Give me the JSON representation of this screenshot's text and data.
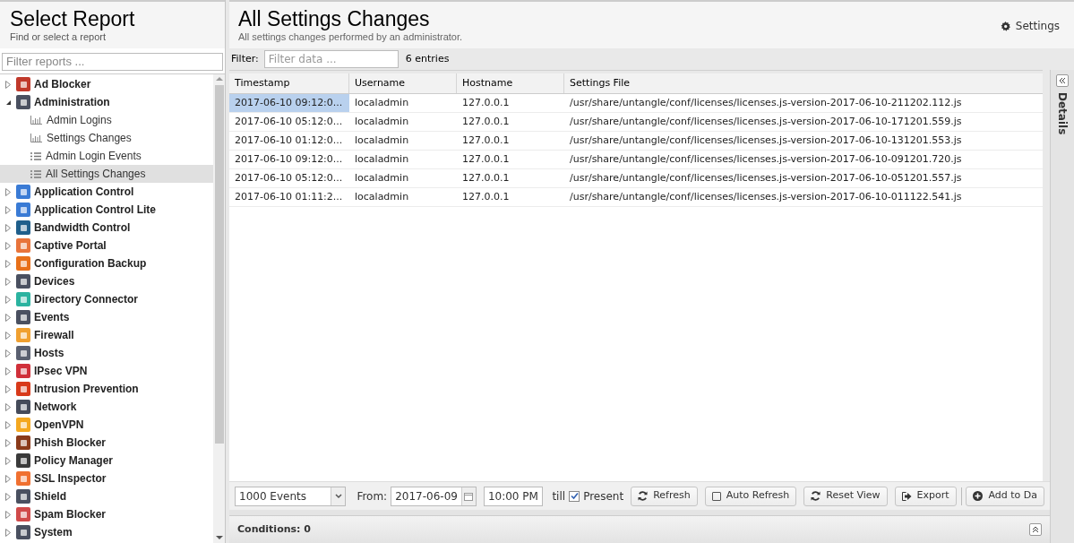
{
  "sidebar": {
    "title": "Select Report",
    "subtitle": "Find or select a report",
    "filter_placeholder": "Filter reports ...",
    "tree": [
      {
        "label": "Ad Blocker",
        "color": "#c0392b",
        "expanded": false
      },
      {
        "label": "Administration",
        "color": "#4a5060",
        "expanded": true,
        "children": [
          {
            "label": "Admin Logins",
            "kind": "chart",
            "selected": false
          },
          {
            "label": "Settings Changes",
            "kind": "chart",
            "selected": false
          },
          {
            "label": "Admin Login Events",
            "kind": "list",
            "selected": false
          },
          {
            "label": "All Settings Changes",
            "kind": "list",
            "selected": true
          }
        ]
      },
      {
        "label": "Application Control",
        "color": "#3a7bd5",
        "expanded": false
      },
      {
        "label": "Application Control Lite",
        "color": "#3a7bd5",
        "expanded": false
      },
      {
        "label": "Bandwidth Control",
        "color": "#1f5f8b",
        "expanded": false
      },
      {
        "label": "Captive Portal",
        "color": "#e8743b",
        "expanded": false
      },
      {
        "label": "Configuration Backup",
        "color": "#e8701a",
        "expanded": false
      },
      {
        "label": "Devices",
        "color": "#4a5060",
        "expanded": false
      },
      {
        "label": "Directory Connector",
        "color": "#2bb3a0",
        "expanded": false
      },
      {
        "label": "Events",
        "color": "#4a5060",
        "expanded": false
      },
      {
        "label": "Firewall",
        "color": "#f0a030",
        "expanded": false
      },
      {
        "label": "Hosts",
        "color": "#5a6070",
        "expanded": false
      },
      {
        "label": "IPsec VPN",
        "color": "#d0303a",
        "expanded": false
      },
      {
        "label": "Intrusion Prevention",
        "color": "#d83a1a",
        "expanded": false
      },
      {
        "label": "Network",
        "color": "#454b5a",
        "expanded": false
      },
      {
        "label": "OpenVPN",
        "color": "#f4a820",
        "expanded": false
      },
      {
        "label": "Phish Blocker",
        "color": "#8a3a1a",
        "expanded": false
      },
      {
        "label": "Policy Manager",
        "color": "#3a3a3a",
        "expanded": false
      },
      {
        "label": "SSL Inspector",
        "color": "#f07030",
        "expanded": false
      },
      {
        "label": "Shield",
        "color": "#4a5060",
        "expanded": false
      },
      {
        "label": "Spam Blocker",
        "color": "#d04a4a",
        "expanded": false
      },
      {
        "label": "System",
        "color": "#4a5060",
        "expanded": false
      }
    ]
  },
  "report": {
    "title": "All Settings Changes",
    "subtitle": "All settings changes performed by an administrator.",
    "settings_button": "Settings",
    "filter_label": "Filter:",
    "filter_placeholder": "Filter data ...",
    "entries": "6 entries",
    "table": {
      "columns": [
        "Timestamp",
        "Username",
        "Hostname",
        "Settings File"
      ],
      "rows": [
        {
          "cells": [
            "2017-06-10 09:12:0...",
            "localadmin",
            "127.0.0.1",
            "/usr/share/untangle/conf/licenses/licenses.js-version-2017-06-10-211202.112.js"
          ],
          "selected": true
        },
        {
          "cells": [
            "2017-06-10 05:12:0...",
            "localadmin",
            "127.0.0.1",
            "/usr/share/untangle/conf/licenses/licenses.js-version-2017-06-10-171201.559.js"
          ],
          "selected": false
        },
        {
          "cells": [
            "2017-06-10 01:12:0...",
            "localadmin",
            "127.0.0.1",
            "/usr/share/untangle/conf/licenses/licenses.js-version-2017-06-10-131201.553.js"
          ],
          "selected": false
        },
        {
          "cells": [
            "2017-06-10 09:12:0...",
            "localadmin",
            "127.0.0.1",
            "/usr/share/untangle/conf/licenses/licenses.js-version-2017-06-10-091201.720.js"
          ],
          "selected": false
        },
        {
          "cells": [
            "2017-06-10 05:12:0...",
            "localadmin",
            "127.0.0.1",
            "/usr/share/untangle/conf/licenses/licenses.js-version-2017-06-10-051201.557.js"
          ],
          "selected": false
        },
        {
          "cells": [
            "2017-06-10 01:11:2...",
            "localadmin",
            "127.0.0.1",
            "/usr/share/untangle/conf/licenses/licenses.js-version-2017-06-10-011122.541.js"
          ],
          "selected": false
        }
      ]
    },
    "details_label": "Details",
    "toolbar": {
      "events_select": "1000 Events",
      "from_label": "From:",
      "from_date": "2017-06-09",
      "from_time": "10:00 PM",
      "till_label": "till",
      "present": {
        "label": "Present",
        "checked": true
      },
      "buttons": [
        {
          "label": "Refresh",
          "kind": "refresh"
        },
        {
          "label": "Auto Refresh",
          "kind": "checkbox",
          "checked": false
        },
        {
          "label": "Reset View",
          "kind": "refresh"
        },
        {
          "label": "Export",
          "kind": "export"
        },
        {
          "label": "Add to Da",
          "kind": "add"
        }
      ]
    },
    "conditions": "Conditions: 0"
  }
}
